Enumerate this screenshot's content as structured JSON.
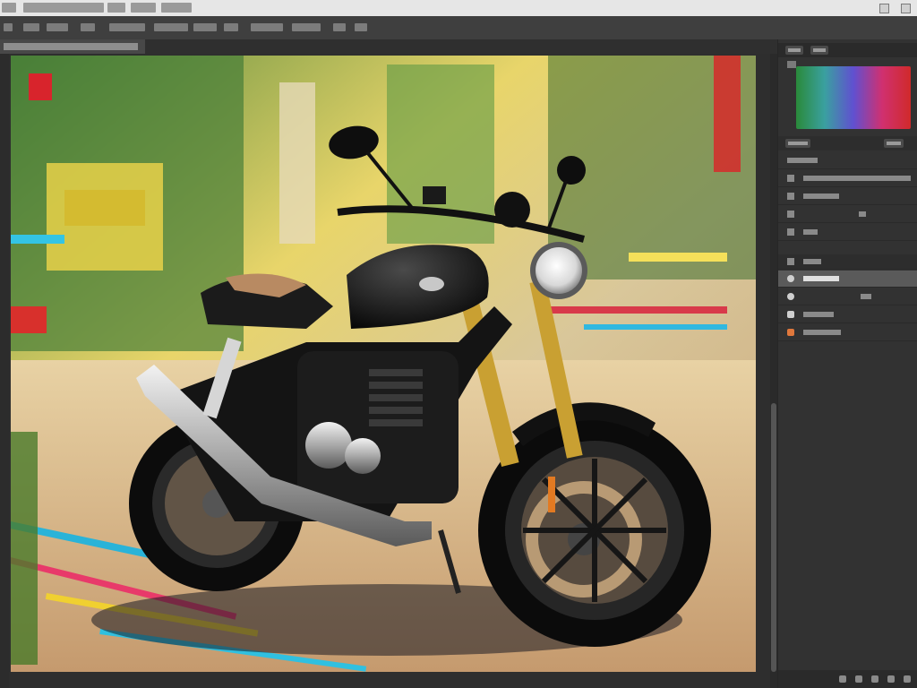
{
  "colors": {
    "chrome_light": "#e6e6e6",
    "chrome_dark": "#3f3f3f",
    "panel_bg": "#323232",
    "selected_row": "#5a5a5a",
    "accent_orange": "#e0783c"
  },
  "menu": {
    "items": [
      "",
      "",
      "",
      "",
      "",
      "",
      "",
      ""
    ]
  },
  "options_bar": {
    "items": [
      "",
      "",
      "",
      "",
      "",
      "",
      "",
      "",
      "",
      "",
      ""
    ]
  },
  "document": {
    "tab_label": ""
  },
  "panels": {
    "top_tabs": [
      "",
      ""
    ],
    "middle_tabs": [
      "",
      ""
    ],
    "adjust_rows": [
      "",
      "",
      "",
      ""
    ],
    "layers_header": "",
    "layers": [
      {
        "name": "",
        "selected": true,
        "icon": "eye-icon"
      },
      {
        "name": "",
        "selected": false,
        "icon": "eye-icon"
      },
      {
        "name": "",
        "selected": false,
        "icon": "mask-icon"
      },
      {
        "name": "",
        "selected": false,
        "icon": "adjustment-icon"
      }
    ]
  },
  "canvas": {
    "subject": "motorcycle-artwork"
  }
}
